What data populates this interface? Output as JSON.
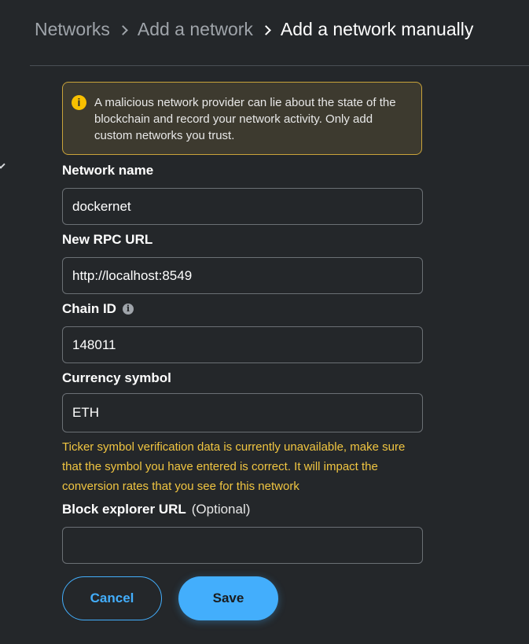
{
  "breadcrumb": {
    "items": [
      "Networks",
      "Add a network"
    ],
    "current": "Add a network manually"
  },
  "warning": {
    "icon": "info-icon",
    "text": "A malicious network provider can lie about the state of the blockchain and record your network activity. Only add custom networks you trust."
  },
  "form": {
    "network_name": {
      "label": "Network name",
      "value": "dockernet"
    },
    "rpc_url": {
      "label": "New RPC URL",
      "value": "http://localhost:8549"
    },
    "chain_id": {
      "label": "Chain ID",
      "value": "148011"
    },
    "currency_symbol": {
      "label": "Currency symbol",
      "value": "ETH",
      "warning": "Ticker symbol verification data is currently unavailable, make sure that the symbol you have entered is correct. It will impact the conversion rates that you see for this network"
    },
    "block_explorer": {
      "label": "Block explorer URL",
      "optional": "(Optional)",
      "value": ""
    }
  },
  "buttons": {
    "cancel": "Cancel",
    "save": "Save"
  },
  "colors": {
    "background": "#24272a",
    "accent": "#43aefc",
    "warning_border": "#c9a33a",
    "warning_text": "#f0c541"
  }
}
